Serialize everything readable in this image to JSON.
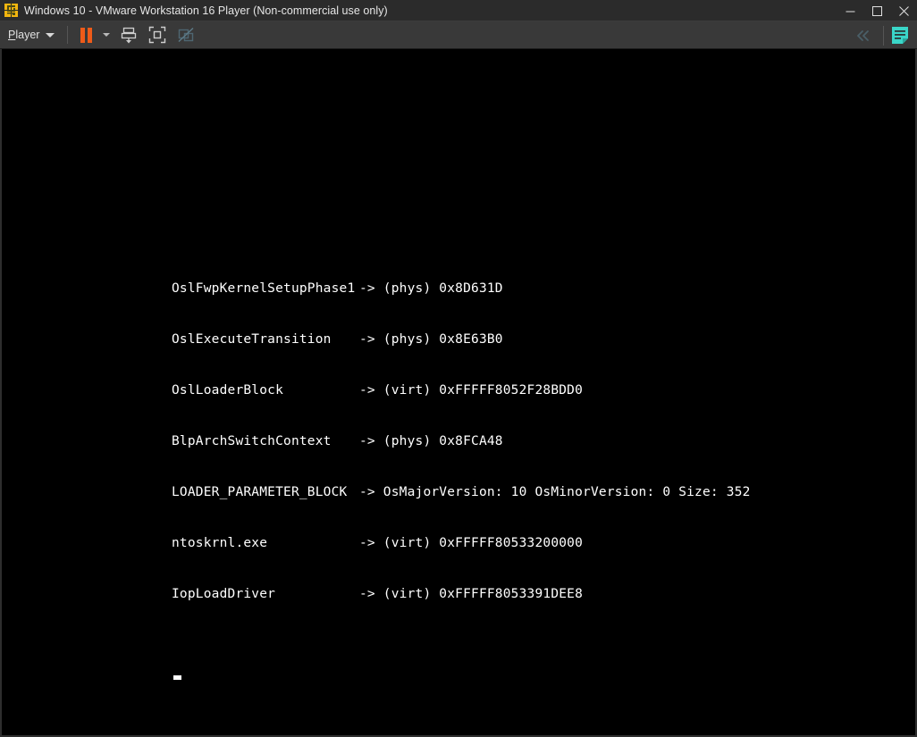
{
  "window": {
    "title": "Windows 10 - VMware Workstation 16 Player (Non-commercial use only)",
    "logo_icon": "vmware-logo-icon",
    "controls": {
      "minimize_icon": "minimize-icon",
      "maximize_icon": "maximize-icon",
      "close_icon": "close-icon"
    }
  },
  "toolbar": {
    "player_menu_label": "Player",
    "player_menu_caret_icon": "chevron-down-icon",
    "pause_icon": "pause-icon",
    "pause_caret_icon": "chevron-down-icon",
    "manage_snapshot_icon": "send-ctrl-alt-del-icon",
    "fullscreen_icon": "enter-fullscreen-icon",
    "unity_mode_icon": "unity-mode-disabled-icon",
    "collapse_icon": "double-chevron-left-icon",
    "notes_icon": "notes-document-icon",
    "accent_orange": "#ee5b19",
    "accent_teal": "#3ad6c8",
    "titlebar_bg": "#2b2b2b",
    "toolbar_bg": "#393939"
  },
  "console": {
    "background": "#000000",
    "foreground": "#ffffff",
    "lines": [
      {
        "symbol": "OslFwpKernelSetupPhase1",
        "value": "-> (phys) 0x8D631D"
      },
      {
        "symbol": "OslExecuteTransition",
        "value": "-> (phys) 0x8E63B0"
      },
      {
        "symbol": "OslLoaderBlock",
        "value": "-> (virt) 0xFFFFF8052F28BDD0"
      },
      {
        "symbol": "BlpArchSwitchContext",
        "value": "-> (phys) 0x8FCA48"
      },
      {
        "symbol": "LOADER_PARAMETER_BLOCK",
        "value": "-> OsMajorVersion: 10 OsMinorVersion: 0 Size: 352"
      },
      {
        "symbol": "ntoskrnl.exe",
        "value": "-> (virt) 0xFFFFF80533200000"
      },
      {
        "symbol": "IopLoadDriver",
        "value": "-> (virt) 0xFFFFF8053391DEE8"
      }
    ],
    "cursor": "_"
  }
}
